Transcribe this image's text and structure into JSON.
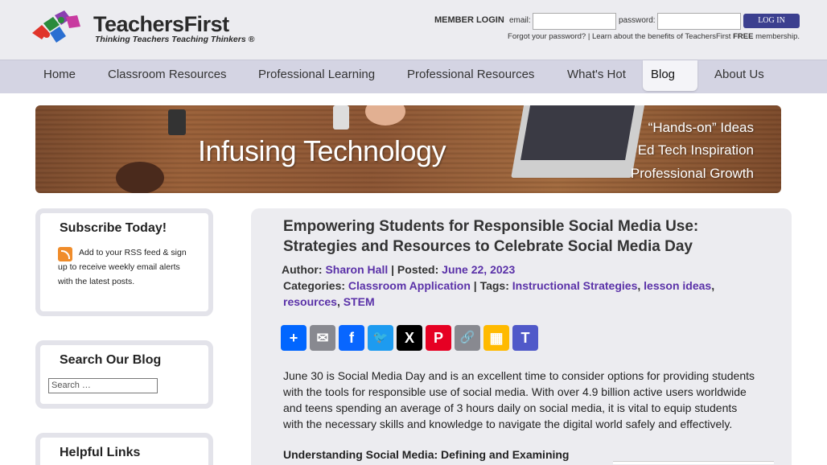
{
  "brand": {
    "name": "TeachersFirst",
    "tagline": "Thinking Teachers Teaching Thinkers ®"
  },
  "login": {
    "member_label": "MEMBER LOGIN",
    "email_label": "email:",
    "email_value": "",
    "password_label": "password:",
    "password_value": "",
    "button_label": "LOG IN",
    "forgot_text": "Forgot your password? |",
    "benefits_prefix": "Learn about the benefits of TeachersFirst",
    "benefits_bold": "FREE",
    "benefits_suffix": "membership."
  },
  "nav": {
    "items": [
      {
        "label": "Home"
      },
      {
        "label": "Classroom Resources"
      },
      {
        "label": "Professional Learning"
      },
      {
        "label": "Professional Resources"
      },
      {
        "label": "What's Hot"
      },
      {
        "label": "Blog"
      },
      {
        "label": "About Us"
      }
    ],
    "active": "Blog"
  },
  "banner": {
    "title": "Infusing Technology",
    "tags": [
      "“Hands-on” Ideas",
      "Ed Tech Inspiration",
      "Professional Growth"
    ]
  },
  "sidebar": {
    "subscribe": {
      "title": "Subscribe Today!",
      "text": "Add to your RSS feed & sign up to receive weekly email alerts with the latest posts."
    },
    "search": {
      "title": "Search Our Blog",
      "placeholder": "Search …"
    },
    "links": {
      "title": "Helpful Links"
    }
  },
  "post": {
    "title": "Empowering Students for Responsible Social Media Use: Strategies and Resources to Celebrate Social Media Day",
    "author_label": "Author:",
    "author": "Sharon Hall",
    "posted_label": "| Posted:",
    "date": "June 22, 2023",
    "categories_label": "Categories:",
    "category": "Classroom Application",
    "tags_label": "| Tags:",
    "tags": [
      "Instructional Strategies",
      "lesson ideas",
      "resources",
      "STEM"
    ],
    "intro": "June 30 is Social Media Day and is an excellent time to consider options for providing students with the tools for responsible use of social media. With over 4.9 billion active users worldwide and teens spending an average of 3 hours daily on social media, it is vital to equip students with the necessary skills and knowledge to navigate the digital world safely and effectively.",
    "subheading": "Understanding Social Media: Defining and Examining"
  },
  "share": [
    {
      "icon": "share-icon",
      "glyph": "+",
      "color": "#0166ff"
    },
    {
      "icon": "email-icon",
      "glyph": "✉",
      "color": "#888990"
    },
    {
      "icon": "facebook-icon",
      "glyph": "f",
      "color": "#0866ff"
    },
    {
      "icon": "twitter-icon",
      "glyph": "🐦",
      "color": "#1d9bf0"
    },
    {
      "icon": "x-icon",
      "glyph": "X",
      "color": "#000000"
    },
    {
      "icon": "pinterest-icon",
      "glyph": "P",
      "color": "#e60023"
    },
    {
      "icon": "copy-link-icon",
      "glyph": "🔗",
      "color": "#888990"
    },
    {
      "icon": "google-classroom-icon",
      "glyph": "▦",
      "color": "#ffba00"
    },
    {
      "icon": "teams-icon",
      "glyph": "T",
      "color": "#5059c9"
    }
  ]
}
